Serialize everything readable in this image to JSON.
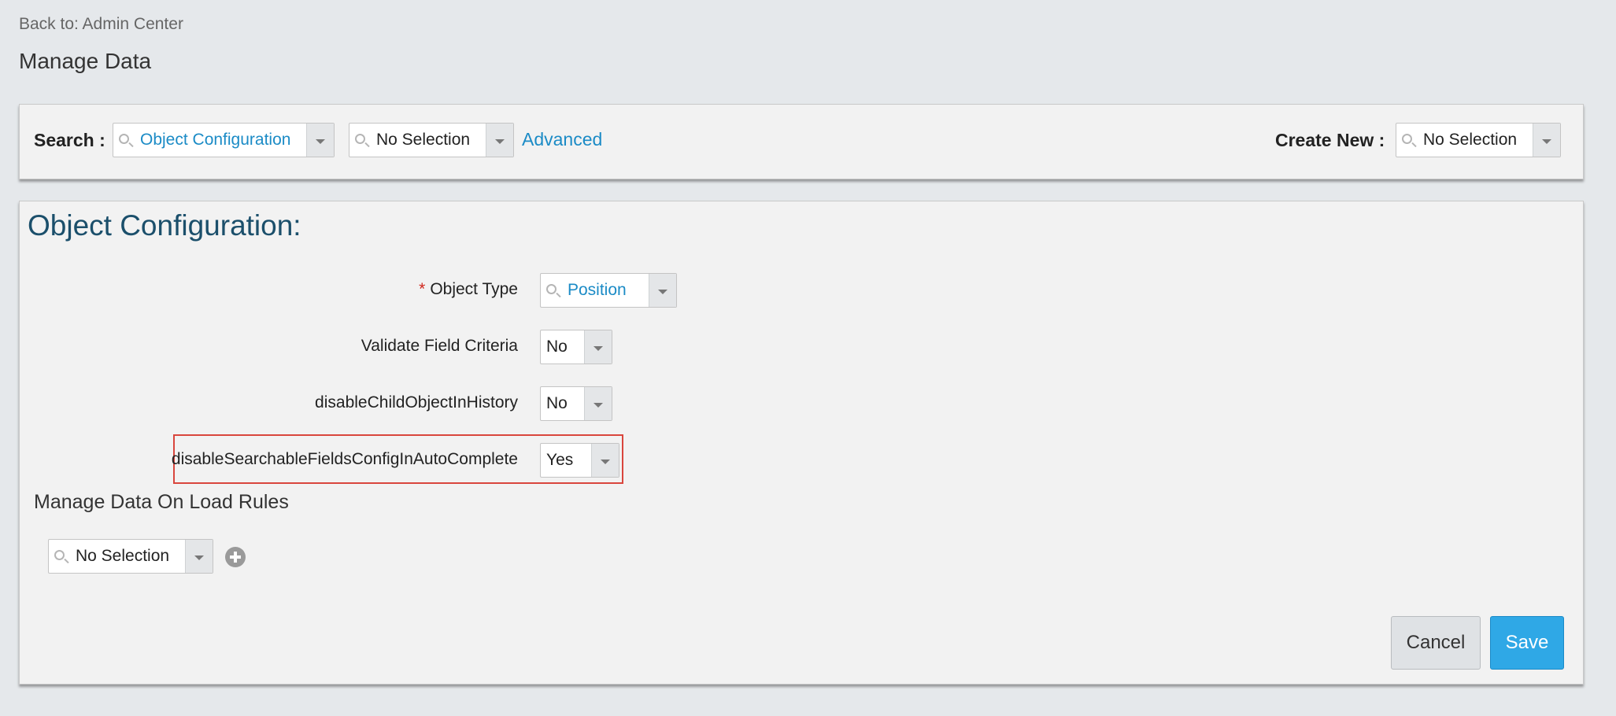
{
  "header": {
    "back_link": "Back to: Admin Center",
    "page_title": "Manage Data"
  },
  "search_bar": {
    "search_label": "Search :",
    "object_combo_value": "Object Configuration",
    "instance_combo_value": "No Selection",
    "advanced_link": "Advanced",
    "create_new_label": "Create New :",
    "create_new_value": "No Selection"
  },
  "form": {
    "title": "Object Configuration:",
    "fields": [
      {
        "label": "Object Type",
        "required": true,
        "value": "Position"
      },
      {
        "label": "Validate Field Criteria",
        "required": false,
        "value": "No"
      },
      {
        "label": "disableChildObjectInHistory",
        "required": false,
        "value": "No"
      },
      {
        "label": "disableSearchableFieldsConfigInAutoComplete",
        "required": false,
        "value": "Yes",
        "highlighted": true
      }
    ],
    "required_marker": "*",
    "on_load_rules_title": "Manage Data On Load Rules",
    "on_load_rules_value": "No Selection"
  },
  "actions": {
    "cancel_label": "Cancel",
    "save_label": "Save"
  },
  "colors": {
    "link": "#1b8bc6",
    "title": "#1b4f6b",
    "save_button": "#2fa8e6",
    "highlight_border": "#d9463d",
    "required": "#d0271d"
  }
}
